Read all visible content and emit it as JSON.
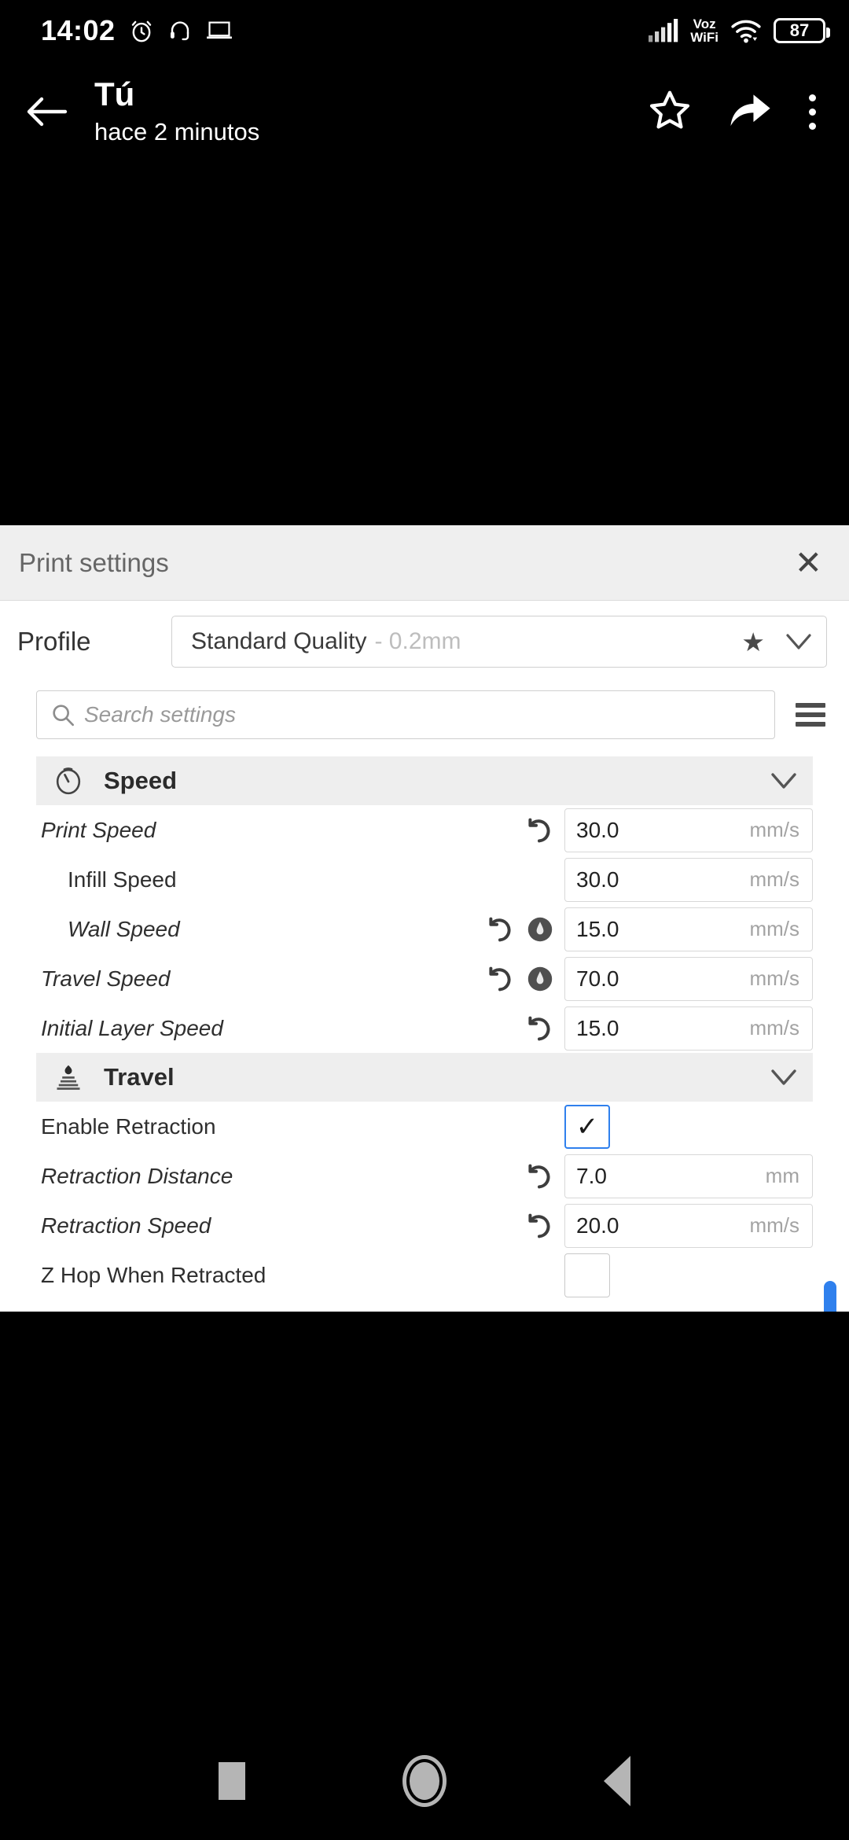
{
  "statusbar": {
    "clock": "14:02",
    "icons": [
      "alarm-icon",
      "headset-icon",
      "laptop-icon"
    ],
    "network_label_line1": "Voz",
    "network_label_line2": "WiFi",
    "battery_percent": "87"
  },
  "appbar": {
    "back_icon": "arrow-left-icon",
    "title": "Tú",
    "subtitle": "hace 2 minutos",
    "star_icon": "star-outline-icon",
    "share_icon": "share-arrow-icon",
    "overflow_icon": "more-vertical-icon"
  },
  "panel": {
    "title": "Print settings",
    "close_label": "✕",
    "profile": {
      "label": "Profile",
      "value_name": "Standard Quality",
      "value_suffix": "- 0.2mm",
      "star_icon": "star-filled-icon",
      "chevron_icon": "chevron-down-icon"
    },
    "search": {
      "placeholder": "Search settings",
      "value": "",
      "icon": "search-icon",
      "menu_icon": "hamburger-menu-icon"
    },
    "sections": [
      {
        "name": "Speed",
        "icon": "speedometer-icon",
        "chevron": "chevron-down-icon",
        "rows": [
          {
            "label": "Print Speed",
            "modified": true,
            "indent": 0,
            "revert": true,
            "inherit": false,
            "type": "number",
            "value": "30.0",
            "unit": "mm/s"
          },
          {
            "label": "Infill Speed",
            "modified": false,
            "indent": 1,
            "revert": false,
            "inherit": false,
            "type": "number",
            "value": "30.0",
            "unit": "mm/s"
          },
          {
            "label": "Wall Speed",
            "modified": true,
            "indent": 1,
            "revert": true,
            "inherit": true,
            "type": "number",
            "value": "15.0",
            "unit": "mm/s"
          },
          {
            "label": "Travel Speed",
            "modified": true,
            "indent": 0,
            "revert": true,
            "inherit": true,
            "type": "number",
            "value": "70.0",
            "unit": "mm/s"
          },
          {
            "label": "Initial Layer Speed",
            "modified": true,
            "indent": 0,
            "revert": true,
            "inherit": false,
            "type": "number",
            "value": "15.0",
            "unit": "mm/s"
          }
        ]
      },
      {
        "name": "Travel",
        "icon": "nozzle-icon",
        "chevron": "chevron-down-icon",
        "rows": [
          {
            "label": "Enable Retraction",
            "modified": false,
            "indent": 0,
            "revert": false,
            "inherit": false,
            "type": "checkbox",
            "checked": true,
            "mark": "✓"
          },
          {
            "label": "Retraction Distance",
            "modified": true,
            "indent": 0,
            "revert": true,
            "inherit": false,
            "type": "number",
            "value": "7.0",
            "unit": "mm"
          },
          {
            "label": "Retraction Speed",
            "modified": true,
            "indent": 0,
            "revert": true,
            "inherit": false,
            "type": "number",
            "value": "20.0",
            "unit": "mm/s"
          },
          {
            "label": "Z Hop When Retracted",
            "modified": false,
            "indent": 0,
            "revert": false,
            "inherit": false,
            "type": "checkbox",
            "checked": false,
            "mark": ""
          }
        ]
      }
    ]
  },
  "navbar": {
    "recents_icon": "square-icon",
    "home_icon": "circle-icon",
    "back_icon": "triangle-left-icon"
  },
  "colors": {
    "accent": "#2f80ed",
    "panel_bg": "#ffffff",
    "header_bg": "#efefef",
    "section_bg": "#eeeeee",
    "status_bg": "#000000"
  }
}
